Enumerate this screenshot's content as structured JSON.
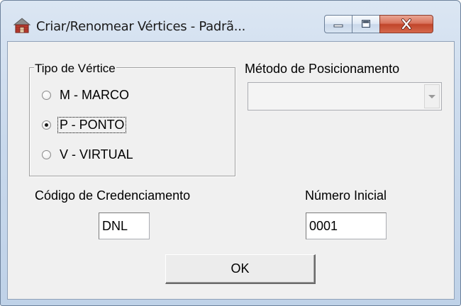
{
  "window": {
    "title": "Criar/Renomear  Vértices - Padrã...",
    "icon": "house-icon",
    "controls": {
      "minimize": "minimize-icon",
      "maximize": "maximize-icon",
      "close": "close-icon"
    }
  },
  "vertex_type": {
    "group_label": "Tipo de Vértice",
    "options": [
      {
        "label": "M - MARCO",
        "selected": false
      },
      {
        "label": "P - PONTO",
        "selected": true
      },
      {
        "label": "V - VIRTUAL",
        "selected": false
      }
    ]
  },
  "positioning": {
    "label": "Método de Posicionamento",
    "selected_value": ""
  },
  "credential": {
    "label": "Código de Credenciamento",
    "value": "DNL"
  },
  "initial_number": {
    "label": "Número Inicial",
    "value": "0001"
  },
  "ok_button": {
    "label": "OK"
  },
  "colors": {
    "client_bg": "#f0f0f0",
    "frame": "#c9d9ec",
    "close_button": "#c0452a"
  }
}
